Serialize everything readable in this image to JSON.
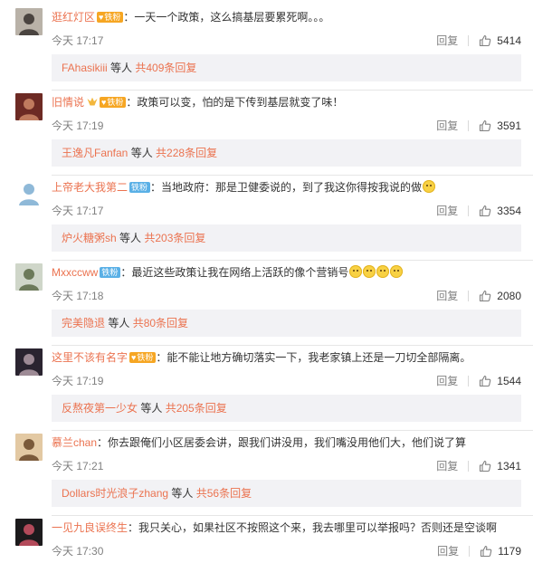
{
  "labels": {
    "reply": "回复",
    "sub_middle": " 等人 "
  },
  "colors": {
    "link": "#eb7350",
    "gold_badge": "#f6a623",
    "blue_badge": "#5ab0e6"
  },
  "comments": [
    {
      "user": "逛红灯区",
      "badge": "铁粉",
      "badge_color": "gold",
      "vip": false,
      "text": "：一天一个政策，这么搞基层要累死啊。。。",
      "emoji_count": 0,
      "time": "今天 17:17",
      "likes": "5414",
      "sub_user": "FAhasikiii",
      "sub_total": "共409条回复"
    },
    {
      "user": "旧情说",
      "badge": "铁粉",
      "badge_color": "gold",
      "vip": true,
      "text": "：政策可以变，怕的是下传到基层就变了味！",
      "emoji_count": 0,
      "time": "今天 17:19",
      "likes": "3591",
      "sub_user": "王逸凡Fanfan",
      "sub_total": "共228条回复"
    },
    {
      "user": "上帝老大我第二",
      "badge": "铁粉",
      "badge_color": "blue",
      "vip": false,
      "text": "：当地政府：那是卫健委说的，到了我这你得按我说的做",
      "emoji_count": 1,
      "time": "今天 17:17",
      "likes": "3354",
      "sub_user": "炉火糖粥sh",
      "sub_total": "共203条回复"
    },
    {
      "user": "Mxxccww",
      "badge": "铁粉",
      "badge_color": "blue",
      "vip": false,
      "text": "：最近这些政策让我在网络上活跃的像个营销号",
      "emoji_count": 4,
      "time": "今天 17:18",
      "likes": "2080",
      "sub_user": "完美隐退",
      "sub_total": "共80条回复"
    },
    {
      "user": "这里不该有名字",
      "badge": "铁粉",
      "badge_color": "gold",
      "vip": false,
      "text": "：能不能让地方确切落实一下，我老家镇上还是一刀切全部隔离。",
      "emoji_count": 0,
      "time": "今天 17:19",
      "likes": "1544",
      "sub_user": "反熬夜第一少女",
      "sub_total": "共205条回复"
    },
    {
      "user": "慕兰chan",
      "badge": "",
      "badge_color": "",
      "vip": false,
      "text": "：你去跟俺们小区居委会讲，跟我们讲没用，我们嘴没用他们大，他们说了算",
      "emoji_count": 0,
      "time": "今天 17:21",
      "likes": "1341",
      "sub_user": "Dollars时光浪子zhang",
      "sub_total": "共56条回复"
    },
    {
      "user": "一见九良误终生",
      "badge": "",
      "badge_color": "",
      "vip": false,
      "text": "：我只关心，如果社区不按照这个来，我去哪里可以举报吗？否则还是空谈啊",
      "emoji_count": 0,
      "time": "今天 17:30",
      "likes": "1179",
      "sub_user": "",
      "sub_total": ""
    }
  ]
}
